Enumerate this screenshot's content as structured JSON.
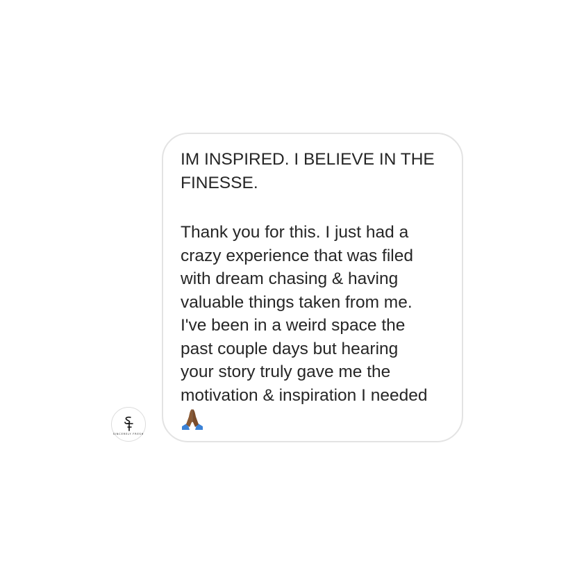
{
  "sender": {
    "avatar_initials": "SF",
    "avatar_caption": "SINCERELY FRESH"
  },
  "message": {
    "line1": "IM INSPIRED. I BELIEVE IN THE\nFINESSE.",
    "line2": "Thank you for this. I just had a\ncrazy experience that was filed\nwith dream chasing & having\nvaluable things taken from me.\nI've been in a weird space the\npast couple days but hearing\nyour story truly gave me the\nmotivation & inspiration I needed",
    "emoji": "folded-hands-icon",
    "emoji_skin": "#8b5a34",
    "emoji_sleeve": "#3b82d6"
  },
  "colors": {
    "bubble_border": "#e3e3e3",
    "text": "#262626"
  }
}
